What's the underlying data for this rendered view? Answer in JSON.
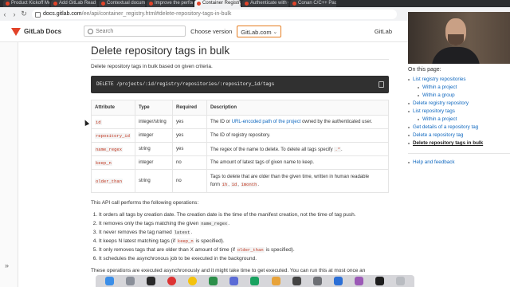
{
  "browser": {
    "tabs": [
      {
        "title": "Product Kickoff Meeti"
      },
      {
        "title": "Add GitLab Read"
      },
      {
        "title": "Contextual docume"
      },
      {
        "title": "Improve the perfor"
      },
      {
        "title": "Container Registry A"
      },
      {
        "title": "Authenticate with C"
      },
      {
        "title": "Conan C/C++ Packa"
      }
    ],
    "active_tab_index": 4,
    "url_host": "docs.gitlab.com",
    "url_rest": "/ee/api/container_registry.html#delete-repository-tags-in-bulk"
  },
  "header": {
    "brand": "GitLab Docs",
    "search_placeholder": "Search",
    "choose_version": "Choose version",
    "version": "GitLab.com",
    "gitlab_link": "GitLab"
  },
  "main": {
    "title": "Delete repository tags in bulk",
    "description": "Delete repository tags in bulk based on given criteria.",
    "endpoint": "DELETE /projects/:id/registry/repositories/:repository_id/tags",
    "table": {
      "headers": [
        "Attribute",
        "Type",
        "Required",
        "Description"
      ],
      "rows": [
        {
          "attribute": "id",
          "type": "integer/string",
          "required": "yes",
          "desc_pre": "The ID or ",
          "desc_link": "URL-encoded path of the project",
          "desc_post": " owned by the authenticated user."
        },
        {
          "attribute": "repository_id",
          "type": "integer",
          "required": "yes",
          "desc_pre": "The ID of registry repository.",
          "desc_link": "",
          "desc_post": ""
        },
        {
          "attribute": "name_regex",
          "type": "string",
          "required": "yes",
          "desc_pre": "The regex of the name to delete. To delete all tags specify ",
          "desc_code": ".*",
          "desc_post": "."
        },
        {
          "attribute": "keep_n",
          "type": "integer",
          "required": "no",
          "desc_pre": "The amount of latest tags of given name to keep.",
          "desc_link": "",
          "desc_post": ""
        },
        {
          "attribute": "older_than",
          "type": "string",
          "required": "no",
          "desc_lines": [
            "Tags to delete that are older than the given time, written in human readable",
            "form "
          ],
          "desc_codes": [
            "1h",
            "1d",
            "1month"
          ]
        }
      ]
    },
    "ops_intro": "This API call performs the following operations:",
    "ops": [
      {
        "pre": "It orders all tags by creation date. The creation date is the time of the manifest creation, not the time of tag push.",
        "code": "",
        "post": ""
      },
      {
        "pre": "It removes only the tags matching the given ",
        "code": "name_regex",
        "post": "."
      },
      {
        "pre": "It never removes the tag named ",
        "code": "latest",
        "post": "."
      },
      {
        "pre": "It keeps N latest matching tags (if ",
        "code": "keep_n",
        "post": " is specified)."
      },
      {
        "pre": "It only removes tags that are older than X amount of time (if ",
        "code": "older_than",
        "post": " is specified)."
      },
      {
        "pre": "It schedules the asynchronous job to be executed in the background.",
        "code": "",
        "post": ""
      }
    ],
    "more": "These operations are executed asynchronously and it might take time to get executed. You can run this at most once an"
  },
  "toc": {
    "heading": "On this page:",
    "items": [
      {
        "label": "List registry repositories",
        "level": 1
      },
      {
        "label": "Within a project",
        "level": 2
      },
      {
        "label": "Within a group",
        "level": 2
      },
      {
        "label": "Delete registry repository",
        "level": 1
      },
      {
        "label": "List repository tags",
        "level": 1
      },
      {
        "label": "Within a project",
        "level": 2
      },
      {
        "label": "Get details of a repository tag",
        "level": 1
      },
      {
        "label": "Delete a repository tag",
        "level": 1
      },
      {
        "label": "Delete repository tags in bulk",
        "level": 1,
        "active": true
      }
    ],
    "help": "Help and feedback"
  },
  "colors": {
    "accent": "#1068bf",
    "brand": "#e24329",
    "version_border": "#e67e22"
  }
}
